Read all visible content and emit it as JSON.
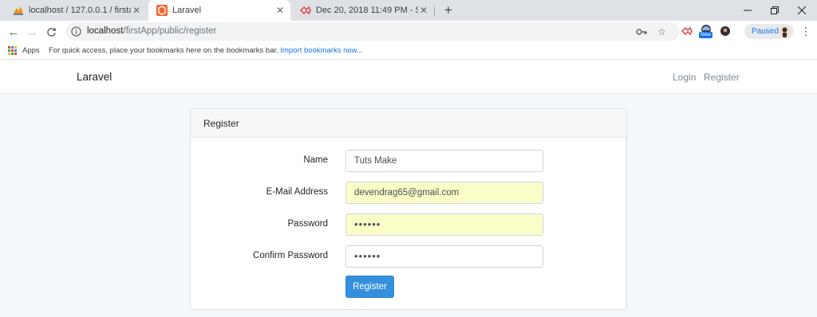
{
  "browser": {
    "tabs": [
      {
        "title": "localhost / 127.0.0.1 / firstapp | p",
        "icon": "phpmyadmin-icon",
        "active": false
      },
      {
        "title": "Laravel",
        "icon": "laravel-icon",
        "active": true
      },
      {
        "title": "Dec 20, 2018 11:49 PM - Screenc",
        "icon": "screencast-icon",
        "active": false
      }
    ],
    "url_host": "localhost",
    "url_path": "/firstApp/public/register",
    "profile_status": "Paused",
    "extension_badge": "New"
  },
  "bookmarks": {
    "apps_label": "Apps",
    "hint": "For quick access, place your bookmarks here on the bookmarks bar.",
    "import_link": "Import bookmarks now..."
  },
  "app": {
    "brand": "Laravel",
    "nav": {
      "login": "Login",
      "register": "Register"
    }
  },
  "card": {
    "header": "Register",
    "fields": {
      "name": {
        "label": "Name",
        "value": "Tuts Make"
      },
      "email": {
        "label": "E-Mail Address",
        "value": "devendrag65@gmail.com"
      },
      "password": {
        "label": "Password",
        "value": "••••••"
      },
      "confirm": {
        "label": "Confirm Password",
        "value": "••••••"
      }
    },
    "submit": "Register"
  },
  "colors": {
    "primary": "#3490dc",
    "autofill": "#fafdc7",
    "page_bg": "#f5f8fa"
  }
}
